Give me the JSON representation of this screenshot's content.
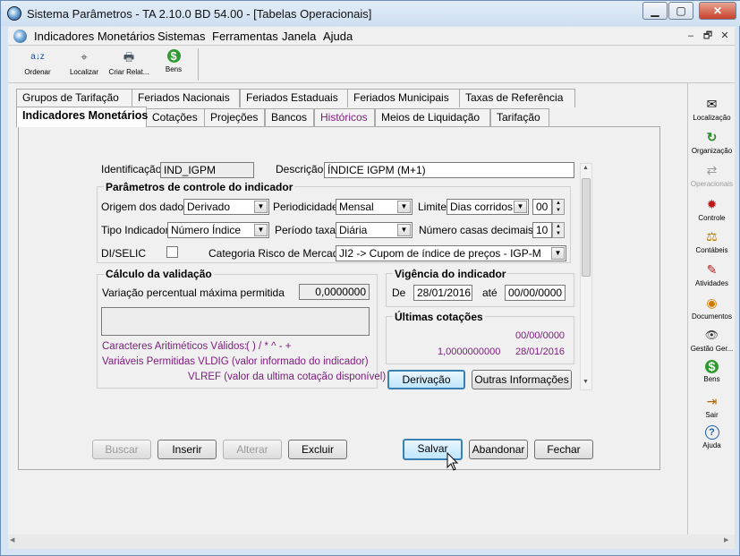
{
  "window": {
    "title": "Sistema Parâmetros -  TA 2.10.0 BD 54.00 - [Tabelas Operacionais]",
    "controls": {
      "minimize": "▁",
      "maximize": "▢",
      "close": "✕"
    }
  },
  "menubar": {
    "items": [
      "Indicadores Monetários",
      "Sistemas",
      "Ferramentas",
      "Janela",
      "Ajuda"
    ],
    "mdi_controls": [
      "–",
      "🗗",
      "✕"
    ]
  },
  "toolbar": {
    "buttons": [
      {
        "label": "Ordenar",
        "icon": "sort-az-icon",
        "glyph": "a↓z"
      },
      {
        "label": "Localizar",
        "icon": "locate-icon",
        "glyph": "⌖"
      },
      {
        "label": "Criar Relat...",
        "icon": "printer-icon",
        "glyph": "🖶"
      },
      {
        "label": "Bens",
        "icon": "money-bag-icon",
        "glyph": "$"
      }
    ]
  },
  "sidebar": {
    "items": [
      {
        "label": "Localização",
        "icon": "message-icon",
        "glyph": "✉",
        "enabled": true
      },
      {
        "label": "Organização",
        "icon": "refresh-icon",
        "glyph": "↻",
        "enabled": true
      },
      {
        "label": "Operacionais",
        "icon": "shuffle-icon",
        "glyph": "⇄",
        "enabled": false
      },
      {
        "label": "Controle",
        "icon": "gear-red-icon",
        "glyph": "✹",
        "enabled": true
      },
      {
        "label": "Contábeis",
        "icon": "scales-icon",
        "glyph": "⚖",
        "enabled": true
      },
      {
        "label": "Atividades",
        "icon": "pin-icon",
        "glyph": "✎",
        "enabled": true
      },
      {
        "label": "Documentos",
        "icon": "document-icon",
        "glyph": "◉",
        "enabled": true
      },
      {
        "label": "Gestão Ger...",
        "icon": "eye-icon",
        "glyph": "👁",
        "enabled": true
      },
      {
        "label": "Bens",
        "icon": "money-bag-icon",
        "glyph": "$",
        "enabled": true
      },
      {
        "label": "Sair",
        "icon": "exit-icon",
        "glyph": "⇥",
        "enabled": true
      },
      {
        "label": "Ajuda",
        "icon": "help-icon",
        "glyph": "?",
        "enabled": true
      }
    ]
  },
  "tabs_row1": [
    "Grupos de Tarifação",
    "Feriados Nacionais",
    "Feriados Estaduais",
    "Feriados Municipais",
    "Taxas de Referência"
  ],
  "tabs_row2": [
    "Indicadores Monetários",
    "Cotações",
    "Projeções",
    "Bancos",
    "Históricos",
    "Meios de Liquidação",
    "Tarifação"
  ],
  "active_tab": "Indicadores Monetários",
  "form": {
    "identificacao_label": "Identificação",
    "identificacao_value": "IND_IGPM",
    "descricao_label": "Descrição",
    "descricao_value": "ÍNDICE IGPM (M+1)",
    "params_title": "Parâmetros de controle do indicador",
    "origem_label": "Origem dos dados",
    "origem_value": "Derivado",
    "periodicidade_label": "Periodicidade",
    "periodicidade_value": "Mensal",
    "limite_label": "Limite",
    "limite_value": "Dias corridos",
    "limite_num": "00",
    "tipo_label": "Tipo Indicador",
    "tipo_value": "Número Índice",
    "periodo_label": "Período taxa",
    "periodo_value": "Diária",
    "casas_label": "Número casas decimais",
    "casas_value": "10",
    "diselic_label": "DI/SELIC",
    "categoria_label": "Categoria Risco de Mercado",
    "categoria_value": "JI2 -> Cupom de índice de preços - IGP-M"
  },
  "validacao": {
    "title": "Cálculo da validação",
    "variacao_label": "Variação percentual máxima permitida",
    "variacao_value": "0,0000000",
    "expression": "",
    "caracteres_label": "Caracteres Aritiméticos Válidos:",
    "caracteres_value": "( ) / * ^ - +",
    "variaveis_label": "Variáveis Permitidas VLDIG  (valor informado do indicador)",
    "vlref_label": "VLREF (valor da ultima cotação disponível)"
  },
  "vigencia": {
    "title": "Vigência do indicador",
    "de_label": "De",
    "de_value": "28/01/2016",
    "ate_label": "até",
    "ate_value": "00/00/0000"
  },
  "cotacoes": {
    "title": "Últimas cotações",
    "line1": "00/00/0000",
    "line2_value": "1,0000000000",
    "line2_date": "28/01/2016"
  },
  "buttons": {
    "derivacao": "Derivação",
    "outras": "Outras Informações",
    "buscar": "Buscar",
    "inserir": "Inserir",
    "alterar": "Alterar",
    "excluir": "Excluir",
    "salvar": "Salvar",
    "abandonar": "Abandonar",
    "fechar": "Fechar"
  },
  "colors": {
    "accent": "#3c7fb1",
    "link_purple": "#7b1a7b",
    "panel": "#f0f0f0"
  }
}
